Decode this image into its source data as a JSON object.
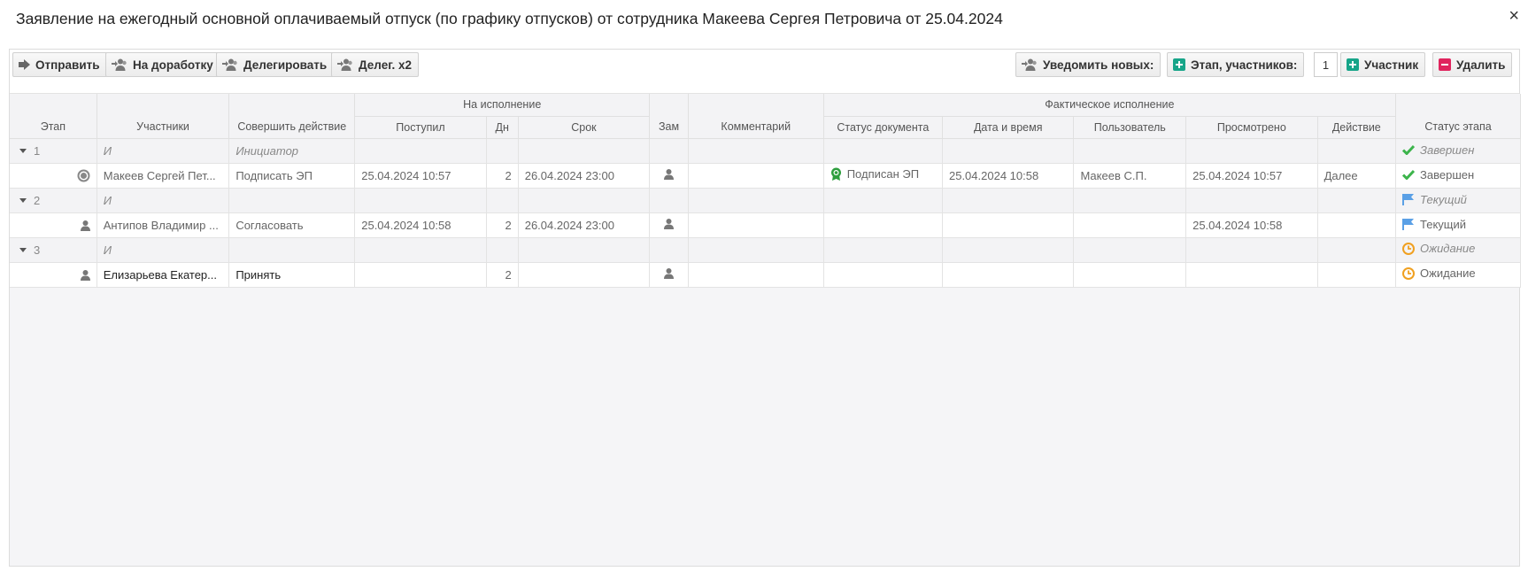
{
  "dialog": {
    "title": "Заявление на ежегодный основной оплачиваемый отпуск (по графику отпусков) от сотрудника Макеева Сергея Петровича от 25.04.2024",
    "close": "×"
  },
  "toolbar": {
    "send": "Отправить",
    "rework": "На доработку",
    "delegate": "Делегировать",
    "delegate2": "Делег. x2",
    "notify_new": "Уведомить новых:",
    "stage_participants": "Этап, участников:",
    "participants_count": "1",
    "participant": "Участник",
    "delete": "Удалить"
  },
  "table": {
    "group_headers": {
      "execution": "На исполнение",
      "actual": "Фактическое исполнение"
    },
    "headers": {
      "stage": "Этап",
      "participants": "Участники",
      "action": "Совершить действие",
      "received": "Поступил",
      "days": "Дн",
      "deadline": "Срок",
      "deputy": "Зам",
      "comment": "Комментарий",
      "doc_status": "Статус документа",
      "datetime": "Дата и время",
      "user": "Пользователь",
      "viewed": "Просмотрено",
      "act": "Действие",
      "stage_status": "Статус этапа"
    },
    "stages": [
      {
        "num": "1",
        "type": "И",
        "action": "Инициатор",
        "status": "Завершен",
        "status_icon": "check-icon",
        "row": {
          "participant": "Макеев Сергей Пет...",
          "action": "Подписать ЭП",
          "received": "25.04.2024 10:57",
          "days": "2",
          "deadline": "26.04.2024 23:00",
          "doc_status": "Подписан ЭП",
          "datetime": "25.04.2024 10:58",
          "user": "Макеев С.П.",
          "viewed": "25.04.2024 10:57",
          "act": "Далее",
          "status": "Завершен",
          "status_icon": "check-icon"
        }
      },
      {
        "num": "2",
        "type": "И",
        "action": "",
        "status": "Текущий",
        "status_icon": "flag-icon",
        "row": {
          "participant": "Антипов Владимир ...",
          "action": "Согласовать",
          "received": "25.04.2024 10:58",
          "days": "2",
          "deadline": "26.04.2024 23:00",
          "doc_status": "",
          "datetime": "",
          "user": "",
          "viewed": "25.04.2024 10:58",
          "act": "",
          "status": "Текущий",
          "status_icon": "flag-icon"
        }
      },
      {
        "num": "3",
        "type": "И",
        "action": "",
        "status": "Ожидание",
        "status_icon": "clock-icon",
        "row": {
          "participant": "Елизарьева Екатер...",
          "action": "Принять",
          "received": "",
          "days": "2",
          "deadline": "",
          "doc_status": "",
          "datetime": "",
          "user": "",
          "viewed": "",
          "act": "",
          "status": "Ожидание",
          "status_icon": "clock-icon"
        }
      }
    ]
  },
  "colors": {
    "check": "#3cb44b",
    "flag": "#5aa0e6",
    "clock": "#f0a020",
    "add": "#17a589",
    "delete": "#e0245e"
  }
}
